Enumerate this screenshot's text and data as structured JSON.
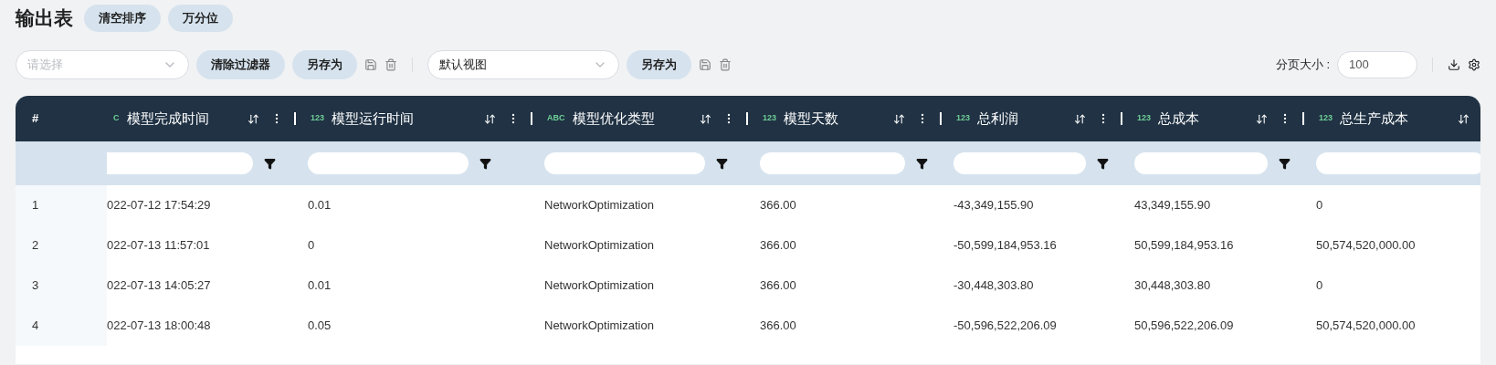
{
  "title": "输出表",
  "header_buttons": [
    "清空排序",
    "万分位"
  ],
  "toolbar": {
    "filter_select": {
      "placeholder": "请选择"
    },
    "clear_filter_button": "清除过滤器",
    "save_as_button": "另存为",
    "view_select": {
      "value": "默认视图"
    },
    "view_save_as_button": "另存为",
    "page_size_label": "分页大小 :",
    "page_size": "100"
  },
  "table": {
    "index_header": "#",
    "columns": [
      {
        "type": "C",
        "label": "模型完成时间",
        "menu": true
      },
      {
        "type": "123",
        "label": "模型运行时间",
        "menu": true
      },
      {
        "type": "ABC",
        "label": "模型优化类型",
        "menu": true
      },
      {
        "type": "123",
        "label": "模型天数",
        "menu": true
      },
      {
        "type": "123",
        "label": "总利润",
        "menu": true
      },
      {
        "type": "123",
        "label": "总成本",
        "menu": true
      },
      {
        "type": "123",
        "label": "总生产成本",
        "menu": false
      }
    ],
    "rows": [
      {
        "index": "1",
        "cells": [
          "022-07-12 17:54:29",
          "0.01",
          "NetworkOptimization",
          "366.00",
          "-43,349,155.90",
          "43,349,155.90",
          "0"
        ]
      },
      {
        "index": "2",
        "cells": [
          "022-07-13 11:57:01",
          "0",
          "NetworkOptimization",
          "366.00",
          "-50,599,184,953.16",
          "50,599,184,953.16",
          "50,574,520,000.00"
        ]
      },
      {
        "index": "3",
        "cells": [
          "022-07-13 14:05:27",
          "0.01",
          "NetworkOptimization",
          "366.00",
          "-30,448,303.80",
          "30,448,303.80",
          "0"
        ]
      },
      {
        "index": "4",
        "cells": [
          "022-07-13 18:00:48",
          "0.05",
          "NetworkOptimization",
          "366.00",
          "-50,596,522,206.09",
          "50,596,522,206.09",
          "50,574,520,000.00"
        ]
      }
    ]
  }
}
